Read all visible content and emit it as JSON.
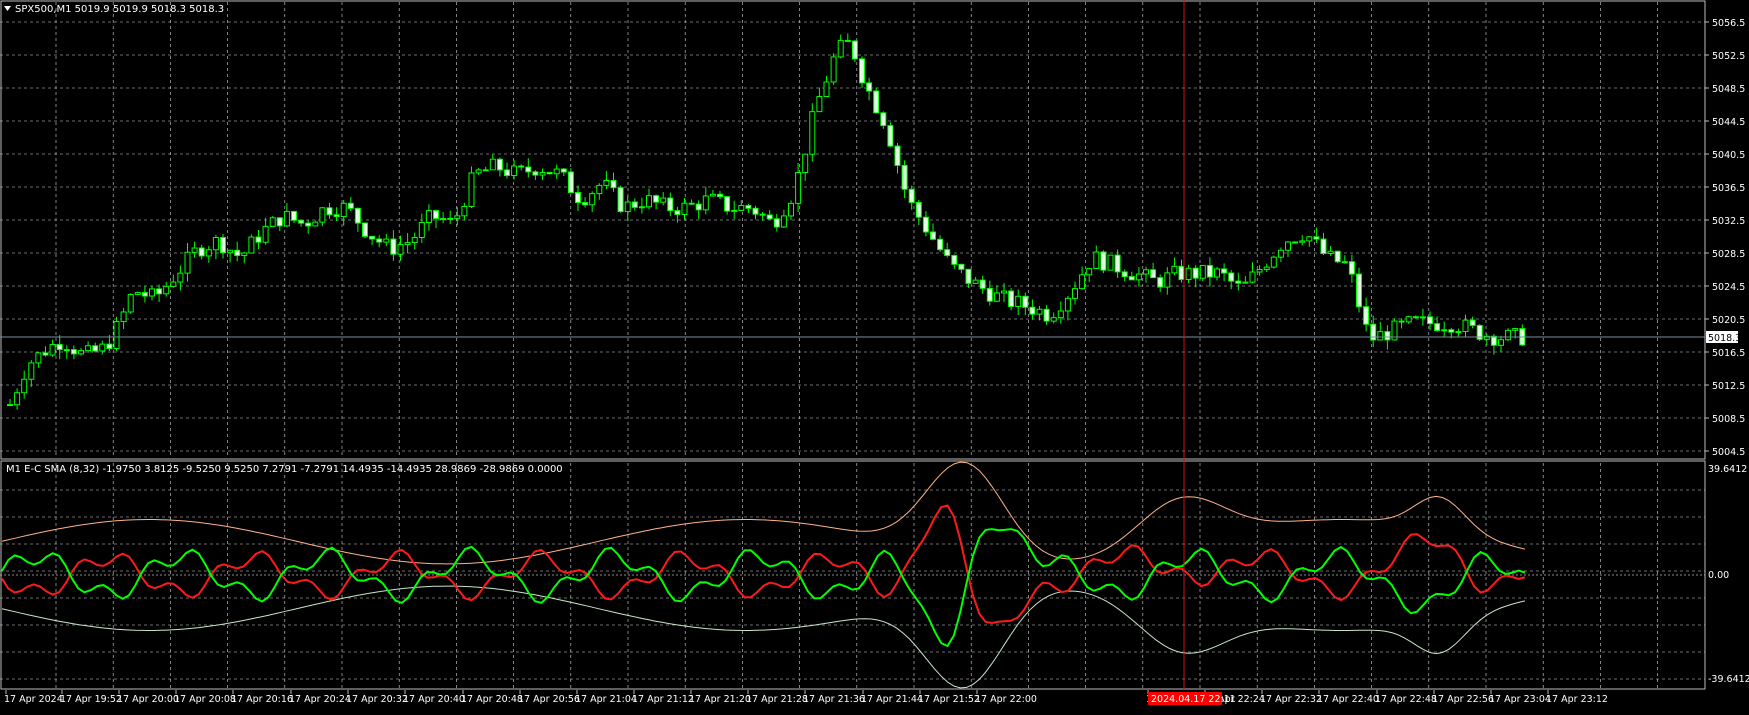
{
  "colors": {
    "background": "#000000",
    "grid": "#d8d8d8",
    "axis": "#bdbdbd",
    "bull_candle": "#00ff00",
    "bear_candle": "#e0ffe0",
    "ind_green": "#00ff00",
    "ind_red": "#ff1a1a",
    "ind_band_light": "#c8e6c8",
    "ind_band_orange": "#ffb38a",
    "crosshair": "#d01010",
    "bid_line": "#7a8ea0",
    "text": "#ffffff",
    "time_highlight_bg": "#ff0000"
  },
  "main_panel": {
    "header": "SPX500,M1  5019.9 5019.9 5018.3 5018.3",
    "price_ticks": [
      "5056.5",
      "5052.5",
      "5048.5",
      "5044.5",
      "5040.5",
      "5036.5",
      "5032.5",
      "5028.5",
      "5024.5",
      "5020.5",
      "5016.5",
      "5012.5",
      "5008.5",
      "5004.5"
    ],
    "current_price": "5018.3"
  },
  "indicator_panel": {
    "header": "M1 E-C SMA (8,32) -1.9750 3.8125 -9.5250 9.5250 7.2791 -7.2791 14.4935 -14.4935 28.9869 -28.9869 0.0000",
    "top_label": "39.6412",
    "zero_label": "0.00",
    "bottom_label": "-39.6412"
  },
  "time_axis": {
    "labels": [
      "17 Apr 2024",
      "17 Apr 19:52",
      "17 Apr 20:00",
      "17 Apr 20:08",
      "17 Apr 20:16",
      "17 Apr 20:24",
      "17 Apr 20:32",
      "17 Apr 20:40",
      "17 Apr 20:48",
      "17 Apr 20:56",
      "17 Apr 21:04",
      "17 Apr 21:12",
      "17 Apr 21:20",
      "17 Apr 21:28",
      "17 Apr 21:36",
      "17 Apr 21:44",
      "17 Apr 21:52",
      "17 Apr 22:00",
      "17 Apr 22:16",
      "17 Apr 22:24",
      "17 Apr 22:32",
      "17 Apr 22:40",
      "17 Apr 22:48",
      "17 Apr 22:56",
      "17 Apr 23:04",
      "17 Apr 23:12"
    ],
    "crosshair_label": "2024.04.17 22:11"
  },
  "chart_data": {
    "type": "candlestick",
    "price_ylim": [
      5004.5,
      5056.5
    ],
    "indicator_ylim": [
      -39.6412,
      39.6412
    ],
    "close_trace": [
      {
        "t": "19:44",
        "p": 5009
      },
      {
        "t": "19:47",
        "p": 5015
      },
      {
        "t": "19:50",
        "p": 5017
      },
      {
        "t": "19:52",
        "p": 5018
      },
      {
        "t": "19:55",
        "p": 5016
      },
      {
        "t": "19:58",
        "p": 5017
      },
      {
        "t": "20:00",
        "p": 5020
      },
      {
        "t": "20:02",
        "p": 5024
      },
      {
        "t": "20:05",
        "p": 5023
      },
      {
        "t": "20:08",
        "p": 5026
      },
      {
        "t": "20:11",
        "p": 5029
      },
      {
        "t": "20:14",
        "p": 5030
      },
      {
        "t": "20:17",
        "p": 5028
      },
      {
        "t": "20:20",
        "p": 5031
      },
      {
        "t": "20:23",
        "p": 5033
      },
      {
        "t": "20:26",
        "p": 5032
      },
      {
        "t": "20:29",
        "p": 5034
      },
      {
        "t": "20:32",
        "p": 5034
      },
      {
        "t": "20:35",
        "p": 5031
      },
      {
        "t": "20:38",
        "p": 5029
      },
      {
        "t": "20:41",
        "p": 5030
      },
      {
        "t": "20:44",
        "p": 5033
      },
      {
        "t": "20:47",
        "p": 5032
      },
      {
        "t": "20:50",
        "p": 5038
      },
      {
        "t": "20:53",
        "p": 5039
      },
      {
        "t": "20:56",
        "p": 5038
      },
      {
        "t": "20:59",
        "p": 5039
      },
      {
        "t": "21:02",
        "p": 5038
      },
      {
        "t": "21:05",
        "p": 5035
      },
      {
        "t": "21:08",
        "p": 5037
      },
      {
        "t": "21:11",
        "p": 5034
      },
      {
        "t": "21:14",
        "p": 5035
      },
      {
        "t": "21:17",
        "p": 5034
      },
      {
        "t": "21:20",
        "p": 5034
      },
      {
        "t": "21:23",
        "p": 5035
      },
      {
        "t": "21:26",
        "p": 5034
      },
      {
        "t": "21:29",
        "p": 5034
      },
      {
        "t": "21:32",
        "p": 5032
      },
      {
        "t": "21:35",
        "p": 5036
      },
      {
        "t": "21:38",
        "p": 5046
      },
      {
        "t": "21:41",
        "p": 5053
      },
      {
        "t": "21:43",
        "p": 5054
      },
      {
        "t": "21:45",
        "p": 5049
      },
      {
        "t": "21:48",
        "p": 5044
      },
      {
        "t": "21:51",
        "p": 5035
      },
      {
        "t": "21:54",
        "p": 5031
      },
      {
        "t": "21:57",
        "p": 5027
      },
      {
        "t": "22:00",
        "p": 5025
      },
      {
        "t": "22:04",
        "p": 5023
      },
      {
        "t": "22:08",
        "p": 5022
      },
      {
        "t": "22:11",
        "p": 5021
      },
      {
        "t": "22:14",
        "p": 5024
      },
      {
        "t": "22:17",
        "p": 5028
      },
      {
        "t": "22:20",
        "p": 5027
      },
      {
        "t": "22:23",
        "p": 5026
      },
      {
        "t": "22:26",
        "p": 5025
      },
      {
        "t": "22:29",
        "p": 5026
      },
      {
        "t": "22:32",
        "p": 5026
      },
      {
        "t": "22:35",
        "p": 5026
      },
      {
        "t": "22:38",
        "p": 5024
      },
      {
        "t": "22:41",
        "p": 5027
      },
      {
        "t": "22:44",
        "p": 5030
      },
      {
        "t": "22:47",
        "p": 5031
      },
      {
        "t": "22:50",
        "p": 5028
      },
      {
        "t": "22:53",
        "p": 5027
      },
      {
        "t": "22:56",
        "p": 5018
      },
      {
        "t": "22:59",
        "p": 5019
      },
      {
        "t": "23:02",
        "p": 5020
      },
      {
        "t": "23:05",
        "p": 5020
      },
      {
        "t": "23:08",
        "p": 5020
      },
      {
        "t": "23:11",
        "p": 5019
      },
      {
        "t": "23:14",
        "p": 5018.3
      }
    ]
  }
}
